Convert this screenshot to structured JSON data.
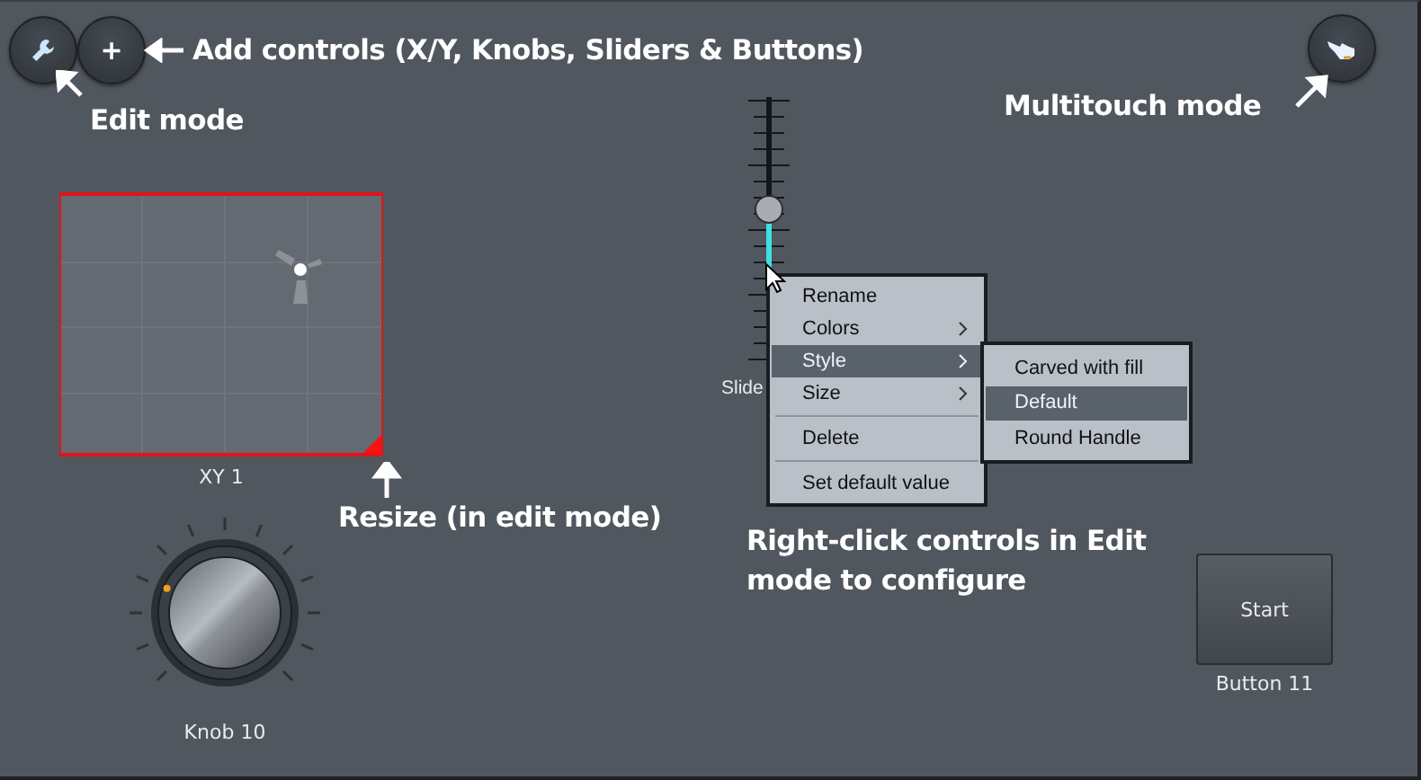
{
  "toolbar": {
    "buttons": [
      {
        "kind": "edit"
      },
      {
        "kind": "add",
        "label": "+"
      },
      {
        "kind": "multitouch"
      }
    ]
  },
  "annotations": [
    {
      "text": "Add controls (X/Y, Knobs, Sliders & Buttons)"
    },
    {
      "text": "Edit mode"
    },
    {
      "text": "Multitouch mode"
    },
    {
      "text": "Resize (in edit mode)"
    },
    {
      "text": "Right-click controls in Edit mode to configure"
    }
  ],
  "controls": [
    {
      "kind": "xy",
      "label": "XY 1",
      "selected": true
    },
    {
      "kind": "slider",
      "label": "Slide",
      "level": 0.58
    },
    {
      "kind": "knob",
      "label": "Knob 10"
    },
    {
      "kind": "button",
      "text": "Start",
      "label": "Button 11"
    }
  ],
  "context_menu": {
    "items": [
      {
        "kind": "item",
        "label": "Rename",
        "selected": false
      },
      {
        "kind": "submenu",
        "label": "Colors",
        "selected": false
      },
      {
        "kind": "submenu",
        "label": "Style",
        "selected": true
      },
      {
        "kind": "submenu",
        "label": "Size",
        "selected": false
      },
      {
        "kind": "separator"
      },
      {
        "kind": "item",
        "label": "Delete",
        "selected": false
      },
      {
        "kind": "separator"
      },
      {
        "kind": "item",
        "label": "Set default value",
        "selected": false
      }
    ],
    "submenu": [
      {
        "label": "Carved with fill",
        "selected": false
      },
      {
        "label": "Default",
        "selected": true
      },
      {
        "label": "Round Handle",
        "selected": false
      }
    ]
  }
}
